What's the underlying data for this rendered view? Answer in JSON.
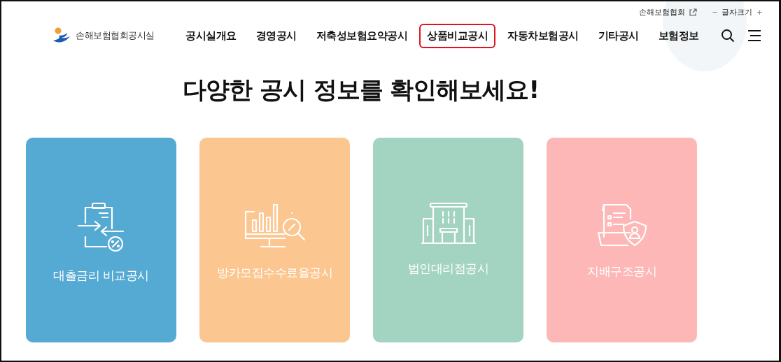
{
  "utility_links": {
    "association": "손해보험협회",
    "font_size": {
      "decrease": "−",
      "label": "글자크기",
      "increase": "+"
    }
  },
  "header": {
    "logo_text": "손해보험협회공시실",
    "nav": [
      {
        "label": "공시실개요",
        "selected": false
      },
      {
        "label": "경영공시",
        "selected": false
      },
      {
        "label": "저축성보험요약공시",
        "selected": false
      },
      {
        "label": "상품비교공시",
        "selected": true
      },
      {
        "label": "자동차보험공시",
        "selected": false
      },
      {
        "label": "기타공시",
        "selected": false
      },
      {
        "label": "보험정보",
        "selected": false
      }
    ]
  },
  "headline": "다양한 공시 정보를 확인해보세요!",
  "cards": [
    {
      "label": "대출금리 비교공시",
      "kind": "loan",
      "color": "#55aad3"
    },
    {
      "label": "방카모집수수료율공시",
      "kind": "chart",
      "color": "#fcc690"
    },
    {
      "label": "법인대리점공시",
      "kind": "building",
      "color": "#a3d3c1"
    },
    {
      "label": "지배구조공시",
      "kind": "document",
      "color": "#fdb7b7"
    }
  ]
}
